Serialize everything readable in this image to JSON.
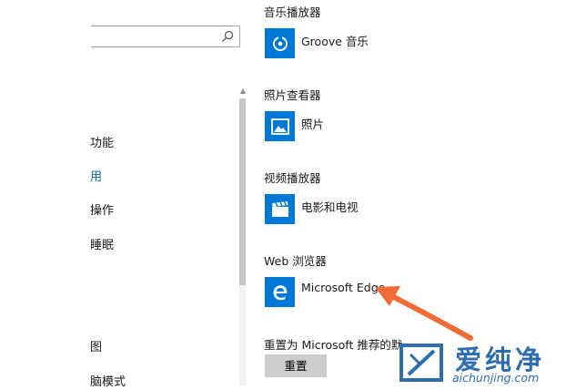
{
  "nav": {
    "items": [
      {
        "label": "功能"
      },
      {
        "label": "用"
      },
      {
        "label": "操作"
      },
      {
        "label": "睡眠"
      },
      {
        "label": "图"
      },
      {
        "label": "脑模式"
      }
    ]
  },
  "sections": [
    {
      "title": "音乐播放器",
      "app": "Groove 音乐",
      "icon": "groove-music-icon"
    },
    {
      "title": "照片查看器",
      "app": "照片",
      "icon": "photos-icon"
    },
    {
      "title": "视频播放器",
      "app": "电影和电视",
      "icon": "movies-tv-icon"
    },
    {
      "title": "Web 浏览器",
      "app": "Microsoft Edge",
      "icon": "edge-icon"
    }
  ],
  "reset": {
    "label": "重置为 Microsoft 推荐的默",
    "button": "重置"
  },
  "watermark": {
    "text": "爱纯净",
    "url": "aichunjing.com"
  },
  "colors": {
    "accent": "#0078d7",
    "active_nav": "#0063b1",
    "arrow": "#f26a34",
    "watermark": "#2f6db3"
  }
}
